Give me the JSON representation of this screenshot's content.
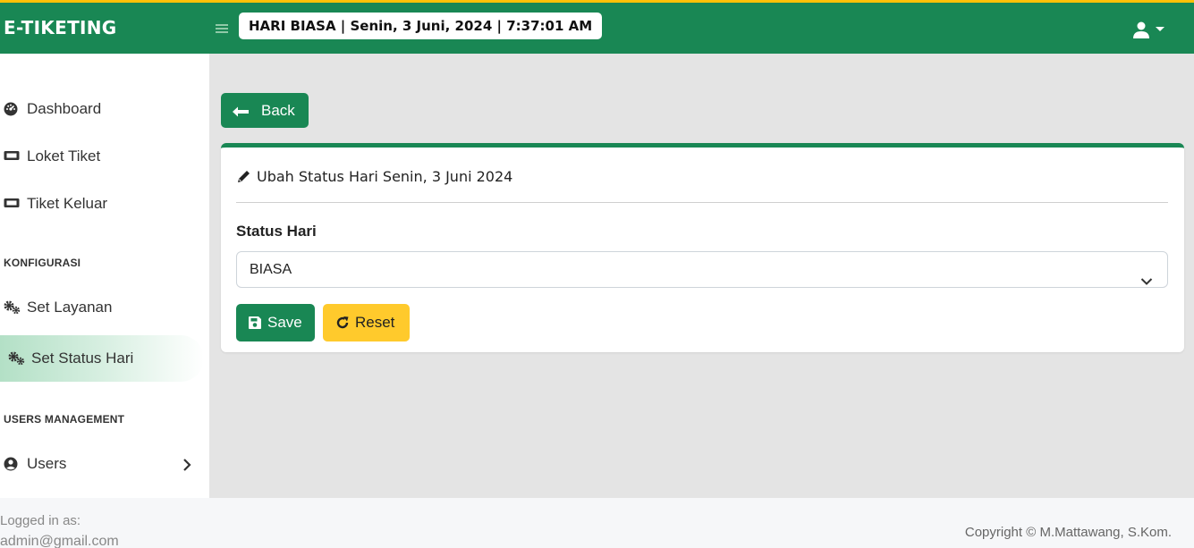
{
  "app": {
    "brand": "E-TIKETING",
    "datetime": "HARI BIASA | Senin, 3 Juni, 2024 | 7:37:01 AM",
    "colors": {
      "primary": "#198754",
      "accent": "#ffc107"
    }
  },
  "sidebar": {
    "items": [
      {
        "label": "Dashboard",
        "icon": "dashboard-icon"
      },
      {
        "label": "Loket Tiket",
        "icon": "ticket-icon"
      },
      {
        "label": "Tiket Keluar",
        "icon": "ticket-icon"
      }
    ],
    "section_config": "KONFIGURASI",
    "config_items": [
      {
        "label": "Set Layanan",
        "icon": "gears-icon"
      },
      {
        "label": "Set Status Hari",
        "icon": "gears-icon",
        "active": true
      }
    ],
    "section_users": "USERS MANAGEMENT",
    "users_item": {
      "label": "Users",
      "icon": "user-circle-icon"
    }
  },
  "main": {
    "back_label": "Back",
    "card_title": "Ubah Status Hari Senin, 3 Juni 2024",
    "field_label": "Status Hari",
    "select_value": "BIASA",
    "save_label": "Save",
    "reset_label": "Reset"
  },
  "footer": {
    "logged_label": "Logged in as:",
    "logged_email": "admin@gmail.com",
    "copyright": "Copyright © M.Mattawang, S.Kom."
  }
}
